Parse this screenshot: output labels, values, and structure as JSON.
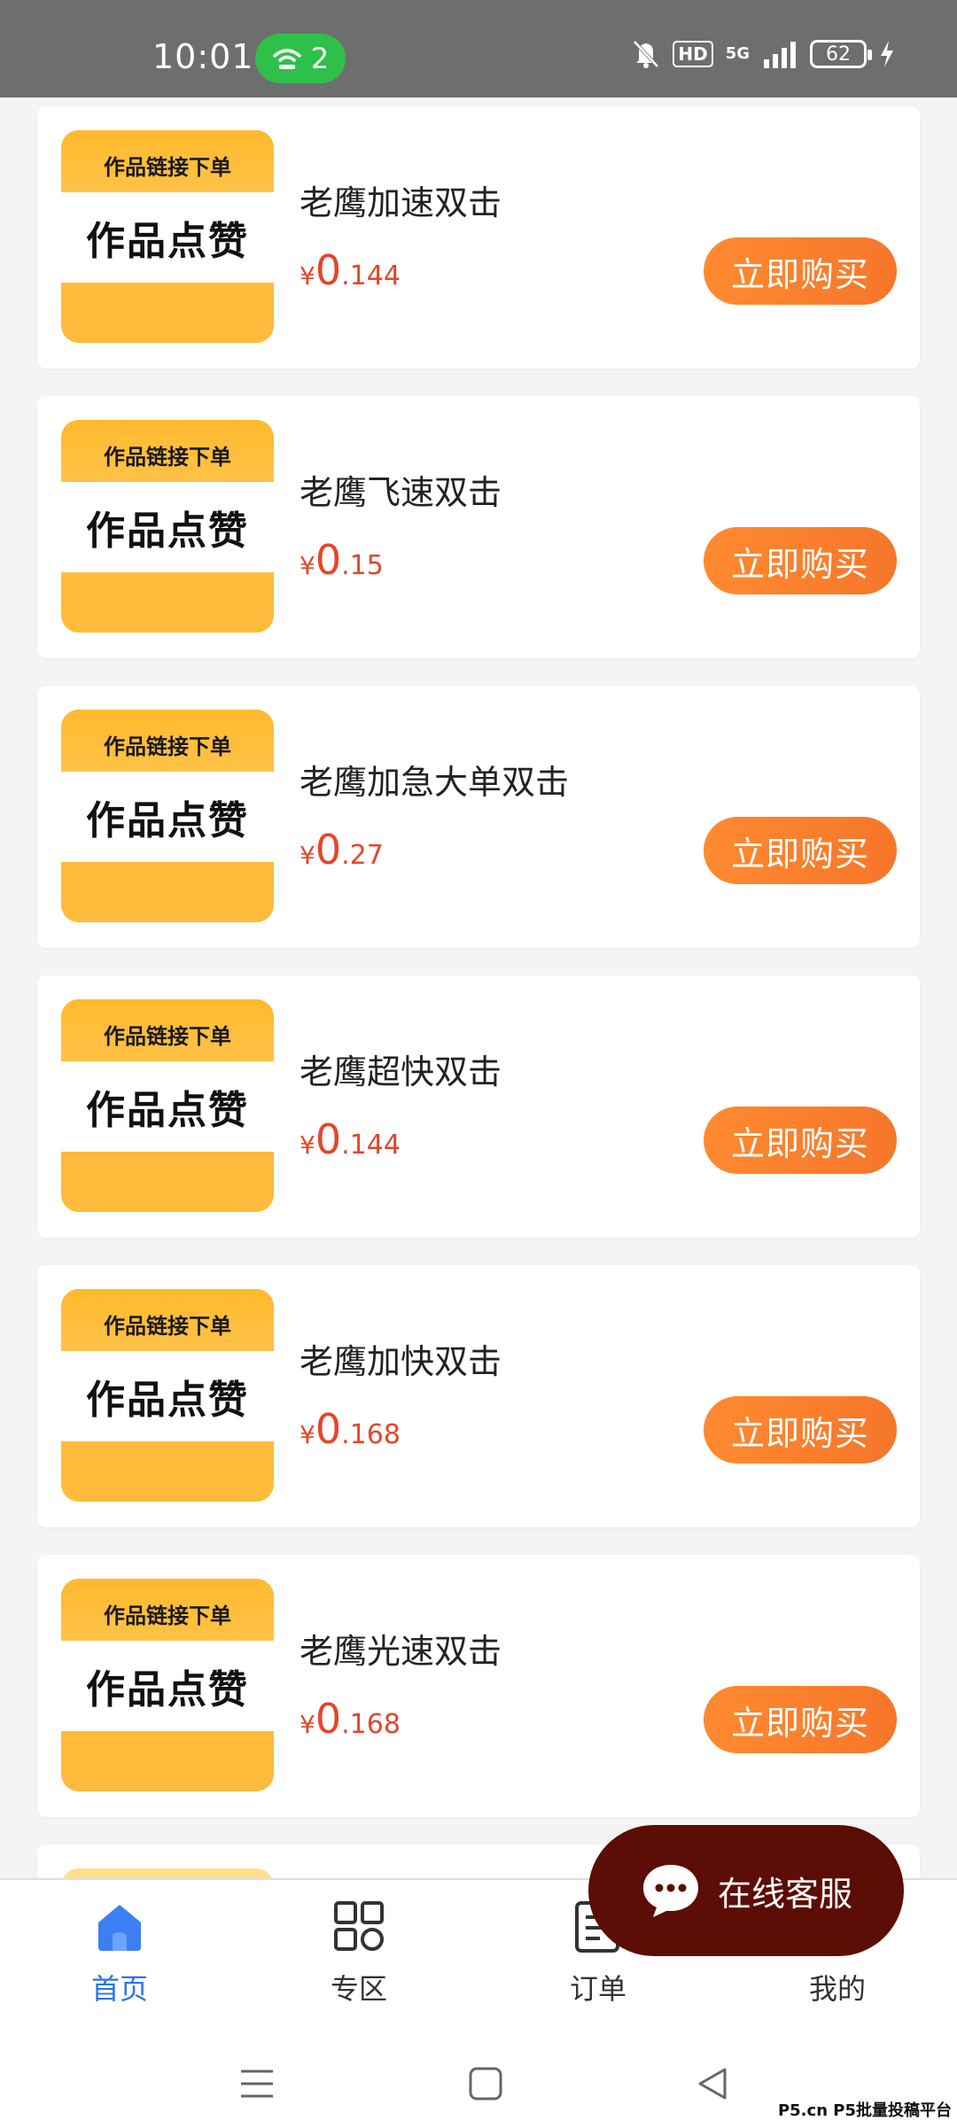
{
  "status": {
    "time": "10:01",
    "hotspot_count": "2",
    "hd": "HD",
    "network": "5G",
    "battery": "62"
  },
  "thumb": {
    "top_label": "作品链接下单",
    "main_label": "作品点赞"
  },
  "products": [
    {
      "name": "老鹰加速双击",
      "currency": "¥",
      "price_int": "0",
      "price_dec": ".144",
      "buy": "立即购买"
    },
    {
      "name": "老鹰飞速双击",
      "currency": "¥",
      "price_int": "0",
      "price_dec": ".15",
      "buy": "立即购买"
    },
    {
      "name": "老鹰加急大单双击",
      "currency": "¥",
      "price_int": "0",
      "price_dec": ".27",
      "buy": "立即购买"
    },
    {
      "name": "老鹰超快双击",
      "currency": "¥",
      "price_int": "0",
      "price_dec": ".144",
      "buy": "立即购买"
    },
    {
      "name": "老鹰加快双击",
      "currency": "¥",
      "price_int": "0",
      "price_dec": ".168",
      "buy": "立即购买"
    },
    {
      "name": "老鹰光速双击",
      "currency": "¥",
      "price_int": "0",
      "price_dec": ".168",
      "buy": "立即购买"
    }
  ],
  "bottom_nav": {
    "items": [
      {
        "label": "首页",
        "icon": "home-icon"
      },
      {
        "label": "专区",
        "icon": "grid-icon"
      },
      {
        "label": "订单",
        "icon": "order-icon"
      },
      {
        "label": "我的",
        "icon": "profile-icon"
      }
    ]
  },
  "chat": {
    "label": "在线客服",
    "icon": "chat-bubble-icon"
  },
  "watermark": "P5.cn P5批量投稿平台",
  "colors": {
    "accent": "#f6762a",
    "price": "#e5452a",
    "nav_active": "#2c72f0",
    "chat_bg": "#5c0d05"
  }
}
